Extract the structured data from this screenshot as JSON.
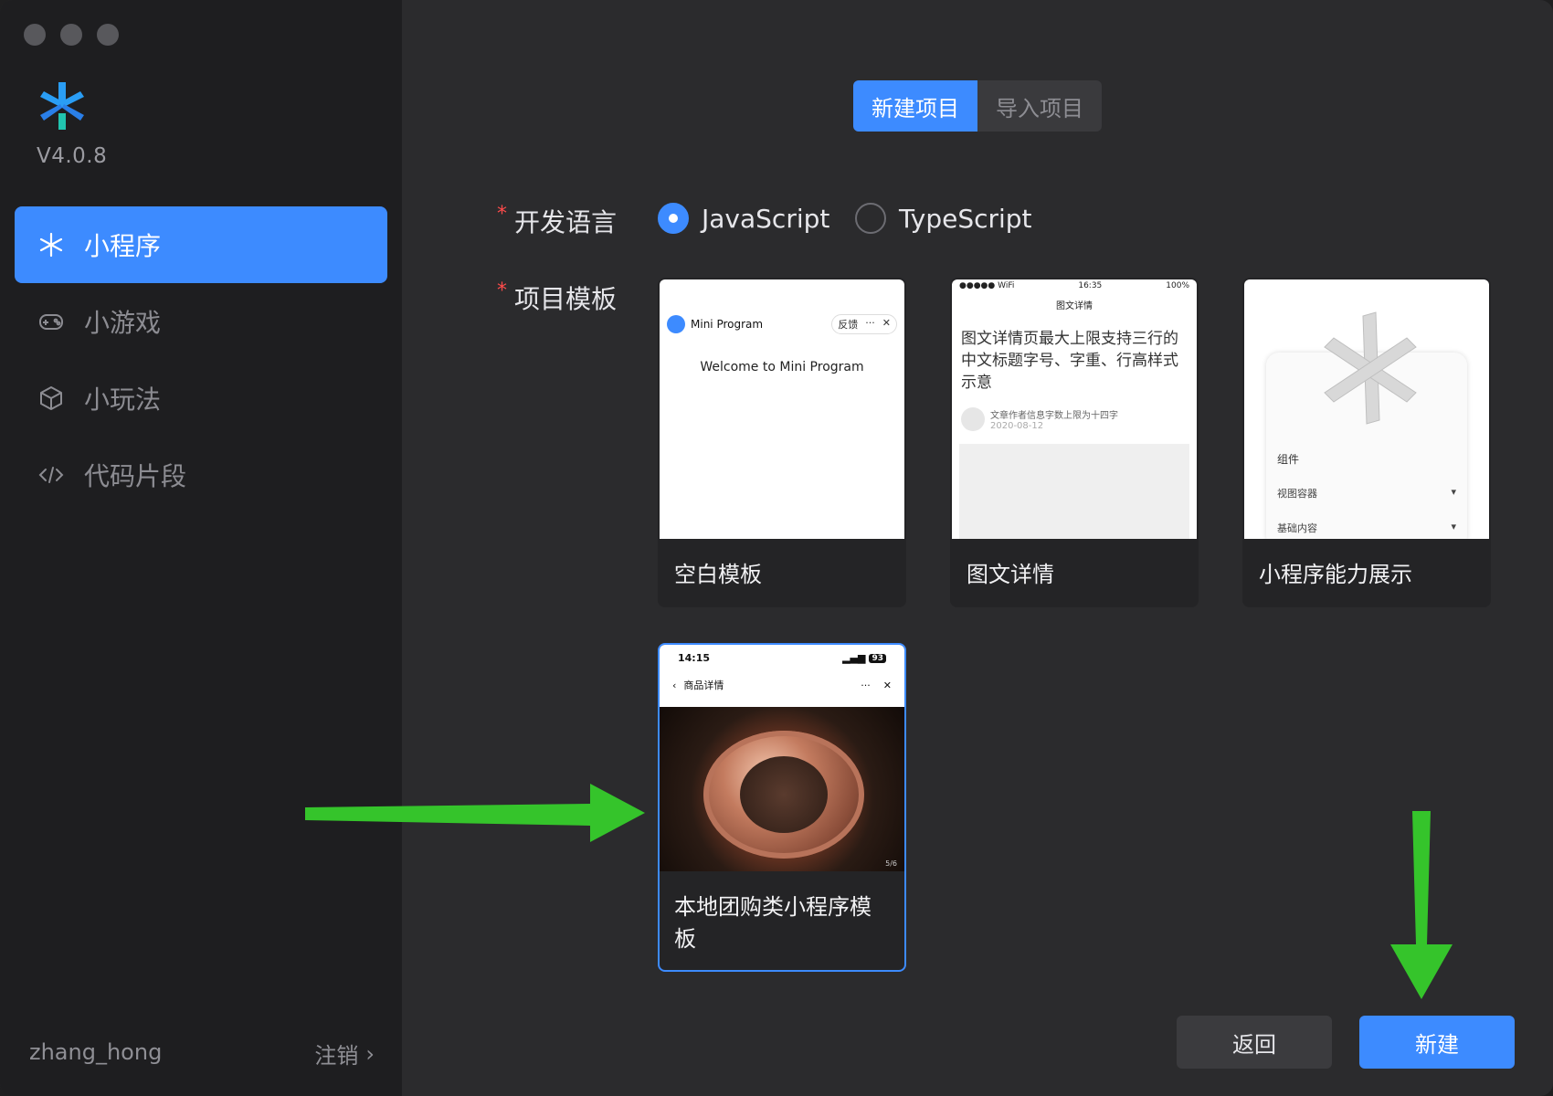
{
  "app": {
    "version": "V4.0.8",
    "user": "zhang_hong",
    "logout_label": "注销",
    "logout_chevron": "›"
  },
  "sidebar": {
    "items": [
      {
        "label": "小程序",
        "icon": "mini-program-icon",
        "active": true
      },
      {
        "label": "小游戏",
        "icon": "gamepad-icon",
        "active": false
      },
      {
        "label": "小玩法",
        "icon": "cube-icon",
        "active": false
      },
      {
        "label": "代码片段",
        "icon": "code-icon",
        "active": false
      }
    ]
  },
  "main": {
    "tabs": [
      {
        "label": "新建项目",
        "active": true
      },
      {
        "label": "导入项目",
        "active": false
      }
    ],
    "language": {
      "label": "开发语言",
      "required_mark": "*",
      "options": [
        {
          "label": "JavaScript",
          "checked": true
        },
        {
          "label": "TypeScript",
          "checked": false
        }
      ]
    },
    "template": {
      "label": "项目模板",
      "required_mark": "*",
      "cards": [
        {
          "title": "空白模板",
          "thumb": {
            "app_name": "Mini Program",
            "feedback": "反馈",
            "more": "···",
            "close": "✕",
            "welcome": "Welcome to Mini Program"
          }
        },
        {
          "title": "图文详情",
          "thumb": {
            "status_left": "●●●●● WiFi",
            "status_time": "16:35",
            "status_right": "100%",
            "nav_title": "图文详情",
            "headline": "图文详情页最大上限支持三行的中文标题字号、字重、行高样式示意",
            "author": "文章作者信息字数上限为十四字",
            "date": "2020-08-12"
          }
        },
        {
          "title": "小程序能力展示",
          "thumb": {
            "section": "组件",
            "row1": "视图容器",
            "row2": "基础内容"
          }
        },
        {
          "title": "本地团购类小程序模板",
          "selected": true,
          "thumb": {
            "time": "14:15",
            "battery": "93",
            "nav_title": "商品详情",
            "more": "···",
            "close": "✕",
            "pager": "5/6"
          }
        }
      ]
    }
  },
  "footer": {
    "back_label": "返回",
    "create_label": "新建"
  },
  "colors": {
    "accent": "#3d8bff",
    "sidebar_bg": "#1e1e20",
    "main_bg": "#2b2b2d",
    "arrow": "#35c42b"
  }
}
